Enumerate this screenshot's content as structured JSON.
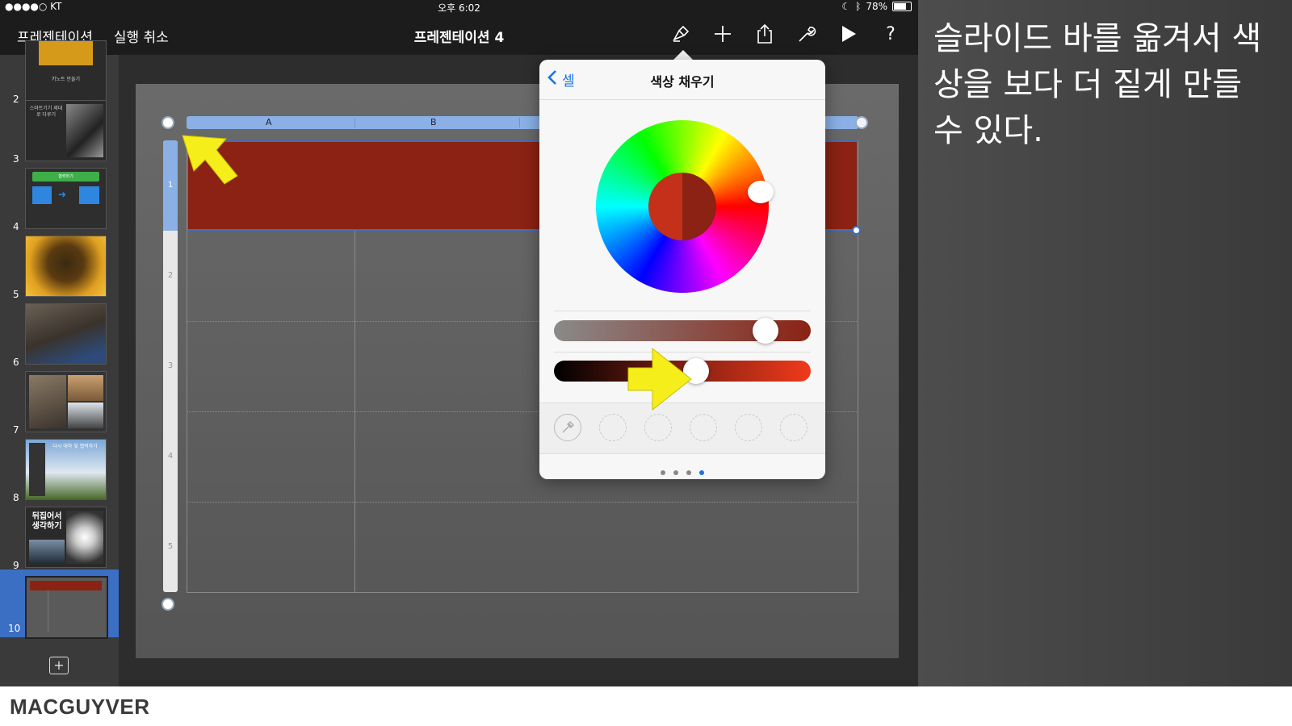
{
  "status_bar": {
    "carrier": "●●●●○ KT",
    "time": "오후 6:02",
    "battery": "78%"
  },
  "toolbar": {
    "presentations_label": "프레젠테이션",
    "undo_label": "실행 취소",
    "document_title": "프레젠테이션 4",
    "icons": [
      "format-brush-icon",
      "plus-icon",
      "share-icon",
      "wrench-icon",
      "play-icon",
      "help-icon"
    ],
    "help_glyph": "?"
  },
  "navigator": {
    "slides": [
      {
        "number": "2",
        "caption": "키노트 만들기"
      },
      {
        "number": "3",
        "caption": "스마트기기 제대로 다루기"
      },
      {
        "number": "4",
        "caption": "협력하기"
      },
      {
        "number": "5"
      },
      {
        "number": "6"
      },
      {
        "number": "7"
      },
      {
        "number": "8",
        "caption": "다시 대하 및 협력하기"
      },
      {
        "number": "9",
        "caption": "뒤집어서 생각하기"
      },
      {
        "number": "10"
      }
    ],
    "selected": "10"
  },
  "table": {
    "columns": [
      "A",
      "B"
    ],
    "rows": [
      "1",
      "2",
      "3",
      "4",
      "5"
    ],
    "fill_color": "#8b2213"
  },
  "popover": {
    "back_label": "셀",
    "title": "색상 채우기",
    "selected_color": "#8b2213",
    "saturation_value": 0.86,
    "brightness_value": 0.56,
    "page_count": 4,
    "current_page": 4
  },
  "annotation": {
    "text": "슬라이드 바를 옮겨서 색상을 보다 더 짙게 만들 수 있다."
  },
  "footer": {
    "brand": "MACGUYVER"
  }
}
